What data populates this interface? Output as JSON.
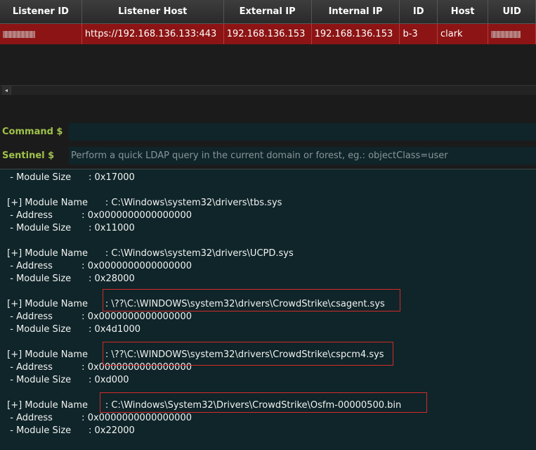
{
  "table": {
    "columns": [
      "Listener ID",
      "Listener Host",
      "External IP",
      "Internal IP",
      "ID",
      "Host",
      "UID"
    ],
    "row": {
      "listener_id": "",
      "listener_host": "https://192.168.136.133:443",
      "external_ip": "192.168.136.153",
      "internal_ip": "192.168.136.153",
      "id": "b-3",
      "host": "clark",
      "uid": ""
    },
    "scroll_left_icon": "◂"
  },
  "command": {
    "label": "Command $",
    "value": ""
  },
  "sentinel": {
    "label": "Sentinel $",
    "placeholder": "Perform a quick LDAP query in the current domain or forest, eg.: objectClass=user"
  },
  "output": {
    "lines": [
      "  - Module Size      : 0x17000",
      "",
      " [+] Module Name      : C:\\Windows\\system32\\drivers\\tbs.sys",
      "  - Address          : 0x0000000000000000",
      "  - Module Size      : 0x11000",
      "",
      " [+] Module Name      : C:\\Windows\\system32\\drivers\\UCPD.sys",
      "  - Address          : 0x0000000000000000",
      "  - Module Size      : 0x28000",
      "",
      " [+] Module Name      : \\??\\C:\\WINDOWS\\system32\\drivers\\CrowdStrike\\csagent.sys",
      "  - Address          : 0x0000000000000000",
      "  - Module Size      : 0x4d1000",
      "",
      " [+] Module Name      : \\??\\C:\\WINDOWS\\system32\\drivers\\CrowdStrike\\cspcm4.sys",
      "  - Address          : 0x0000000000000000",
      "  - Module Size      : 0xd000",
      "",
      " [+] Module Name      : C:\\Windows\\System32\\Drivers\\CrowdStrike\\Osfm-00000500.bin",
      "  - Address          : 0x0000000000000000",
      "  - Module Size      : 0x22000"
    ]
  },
  "colors": {
    "row_selected": "#8c1414",
    "prompt_label": "#a0c24a",
    "console_bg": "#0f2529",
    "highlight_box": "#d42a2a"
  }
}
